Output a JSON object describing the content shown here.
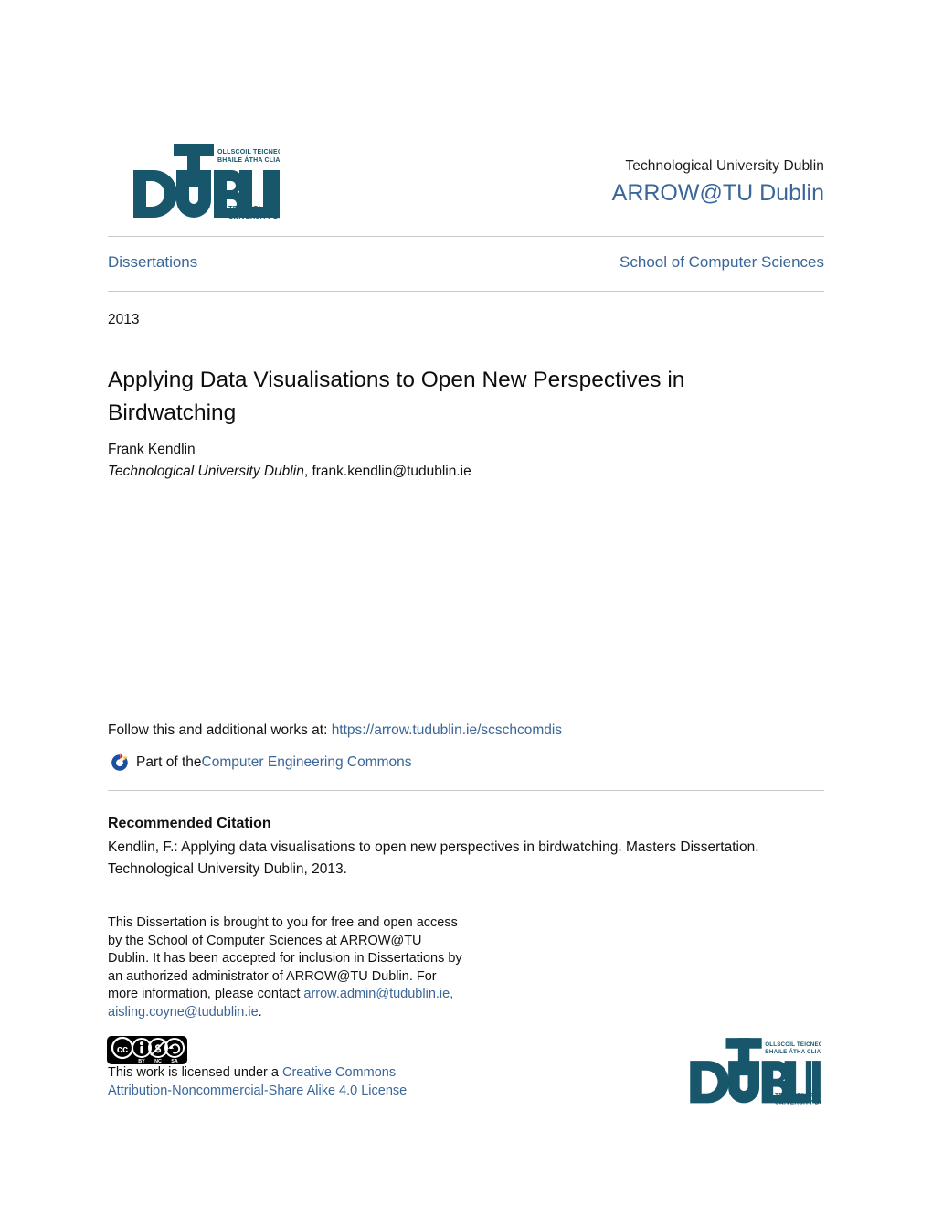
{
  "masthead": {
    "logo_alt": "tu-dublin-logo",
    "logo_words": {
      "big": "DUBLIN",
      "t": "T",
      "u": "U",
      "irish_line1": "OLLSCOIL TEICNEOLAÍOCHTA",
      "irish_line2": "BHAILE ÁTHA CLIATH",
      "sub_line1": "TECHNOLOGICAL",
      "sub_line2": "UNIVERSITY DUBLIN"
    },
    "institution": "Technological University Dublin",
    "repository": "ARROW@TU Dublin"
  },
  "series": {
    "collection": "Dissertations",
    "school": "School of Computer Sciences"
  },
  "article": {
    "year": "2013",
    "title": "Applying Data Visualisations to Open New Perspectives in Birdwatching",
    "author_name": "Frank Kendlin",
    "author_affiliation": "Technological University Dublin",
    "author_separator": ", ",
    "author_email": "frank.kendlin@tudublin.ie"
  },
  "follow": {
    "prefix": "Follow this and additional works at: ",
    "url": "https://arrow.tudublin.ie/scschcomdis",
    "part_of_prefix": "Part of the ",
    "discipline": "Computer Engineering Commons",
    "discipline_icon": "digital-commons-network-icon"
  },
  "citation": {
    "heading": "Recommended Citation",
    "text": "Kendlin, F.: Applying data visualisations to open new perspectives in birdwatching. Masters Dissertation. Technological University Dublin, 2013."
  },
  "disclaimer": {
    "text_before_contact": "This Dissertation is brought to you for free and open access by the School of Computer Sciences at ARROW@TU Dublin. It has been accepted for inclusion in Dissertations by an authorized administrator of ARROW@TU Dublin. For more information, please contact ",
    "email1": "arrow.admin@tudublin.ie,",
    "email2": "aisling.coyne@tudublin.ie",
    "trailing": "."
  },
  "license": {
    "badge_alt": "creative-commons-by-nc-sa-badge",
    "badge_labels": [
      "BY",
      "NC",
      "SA"
    ],
    "badge_mark": "cc",
    "prefix": "This work is licensed under a ",
    "link_line1": "Creative Commons",
    "link_line2": "Attribution-Noncommercial-Share Alike 4.0 License"
  },
  "colors": {
    "link_blue": "#3a6698",
    "logo_teal": "#17566b",
    "rule_grey": "#c9c9c9",
    "text_black": "#111111"
  }
}
